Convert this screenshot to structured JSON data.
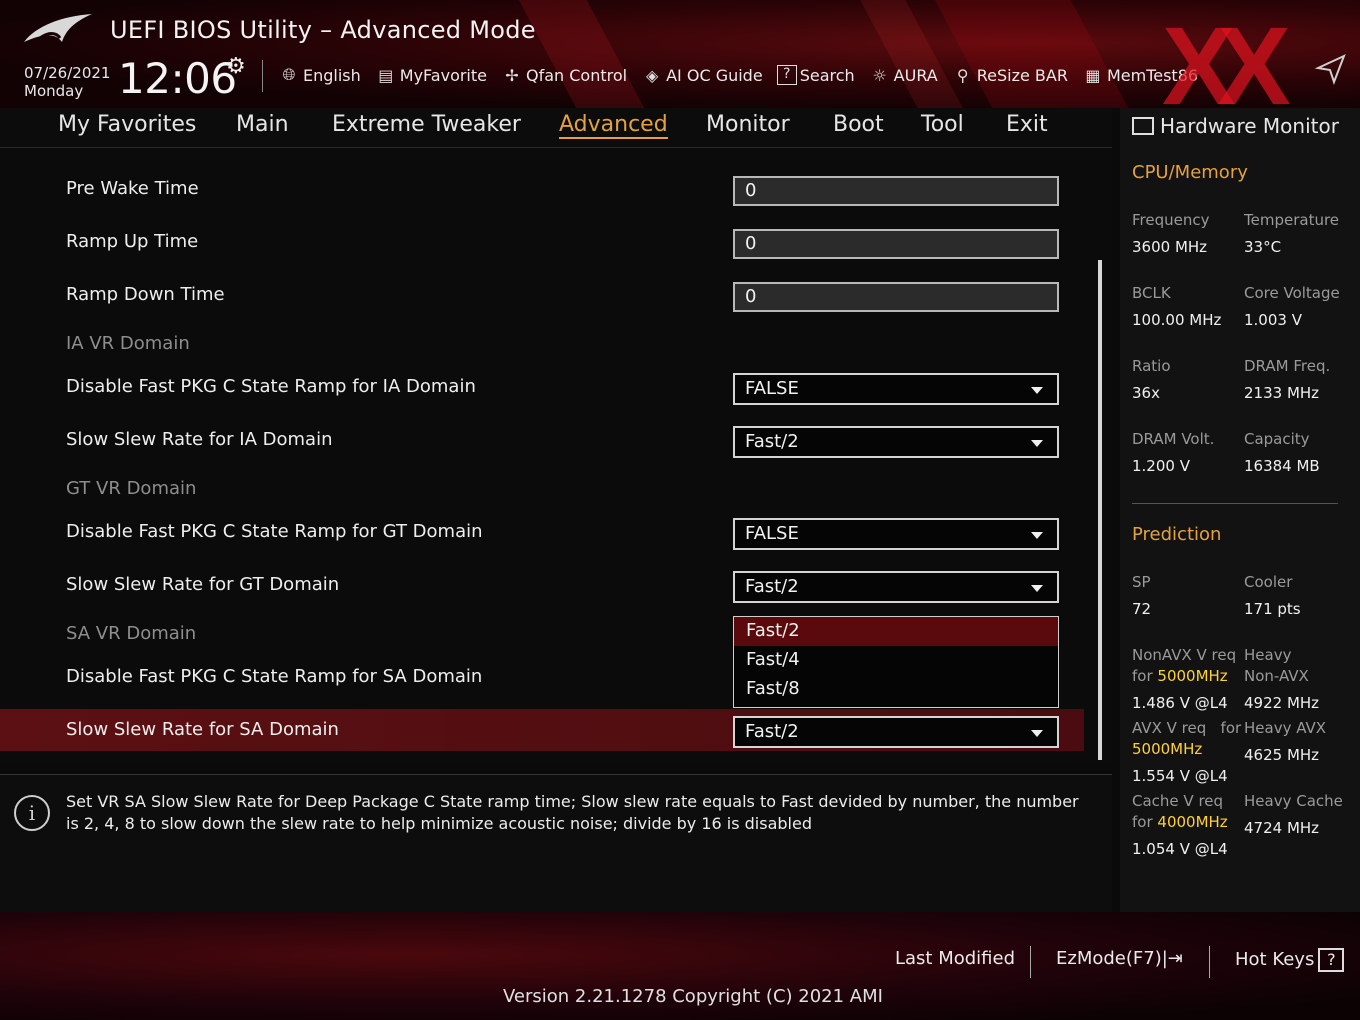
{
  "header": {
    "title": "UEFI BIOS Utility – Advanced Mode",
    "date": "07/26/2021",
    "day": "Monday",
    "time": "12:06",
    "toolbar": [
      {
        "icon": "globe-icon",
        "label": "English"
      },
      {
        "icon": "favorite-list-icon",
        "label": "MyFavorite"
      },
      {
        "icon": "fan-icon",
        "label": "Qfan Control"
      },
      {
        "icon": "ai-chip-icon",
        "label": "AI OC Guide"
      },
      {
        "icon": "search-help-icon",
        "label": "Search"
      },
      {
        "icon": "aura-light-icon",
        "label": "AURA"
      },
      {
        "icon": "resize-bar-icon",
        "label": "ReSize BAR"
      },
      {
        "icon": "memory-icon",
        "label": "MemTest86"
      }
    ]
  },
  "nav": {
    "tabs": [
      "My Favorites",
      "Main",
      "Extreme Tweaker",
      "Advanced",
      "Monitor",
      "Boot",
      "Tool",
      "Exit"
    ],
    "active": "Advanced"
  },
  "settings": {
    "pre_wake": {
      "label": "Pre Wake Time",
      "value": "0"
    },
    "ramp_up": {
      "label": "Ramp Up Time",
      "value": "0"
    },
    "ramp_down": {
      "label": "Ramp Down Time",
      "value": "0"
    },
    "ia_section": "IA VR Domain",
    "ia_fast_pkg": {
      "label": "Disable Fast PKG C State Ramp for IA Domain",
      "value": "FALSE"
    },
    "ia_slew": {
      "label": "Slow Slew Rate for IA Domain",
      "value": "Fast/2"
    },
    "gt_section": "GT VR Domain",
    "gt_fast_pkg": {
      "label": "Disable Fast PKG C State Ramp for GT Domain",
      "value": "FALSE"
    },
    "gt_slew": {
      "label": "Slow Slew Rate for GT Domain",
      "value": "Fast/2"
    },
    "sa_section": "SA VR Domain",
    "sa_fast_pkg": {
      "label": "Disable Fast PKG C State Ramp for SA Domain"
    },
    "sa_slew": {
      "label": "Slow Slew Rate for SA Domain",
      "value": "Fast/2"
    },
    "dropdown_options": [
      "Fast/2",
      "Fast/4",
      "Fast/8"
    ]
  },
  "help": {
    "text": "Set VR SA Slow Slew Rate for Deep Package C State ramp time; Slow slew rate equals to Fast devided by number, the number is 2, 4, 8 to slow down the slew rate to help minimize acoustic noise; divide by 16 is disabled"
  },
  "hw_monitor": {
    "title": "Hardware Monitor",
    "cpu_section": "CPU/Memory",
    "frequency_label": "Frequency",
    "frequency": "3600 MHz",
    "temperature_label": "Temperature",
    "temperature": "33°C",
    "bclk_label": "BCLK",
    "bclk": "100.00 MHz",
    "core_voltage_label": "Core Voltage",
    "core_voltage": "1.003 V",
    "ratio_label": "Ratio",
    "ratio": "36x",
    "dram_freq_label": "DRAM Freq.",
    "dram_freq": "2133 MHz",
    "dram_volt_label": "DRAM Volt.",
    "dram_volt": "1.200 V",
    "capacity_label": "Capacity",
    "capacity": "16384 MB",
    "prediction_section": "Prediction",
    "sp_label": "SP",
    "sp": "72",
    "cooler_label": "Cooler",
    "cooler": "171 pts",
    "nonavx_label_1": "NonAVX V req",
    "nonavx_label_2": "for",
    "nonavx_freq": "5000MHz",
    "nonavx_v": "1.486 V @L4",
    "heavy_nonavx_label_1": "Heavy",
    "heavy_nonavx_label_2": "Non-AVX",
    "heavy_nonavx": "4922 MHz",
    "avx_label": "AVX V req",
    "avx_for": "for",
    "avx_freq": "5000MHz",
    "avx_v": "1.554 V @L4",
    "heavy_avx_label": "Heavy AVX",
    "heavy_avx": "4625 MHz",
    "cache_label_1": "Cache V req",
    "cache_label_2": "for",
    "cache_freq": "4000MHz",
    "cache_v": "1.054 V @L4",
    "heavy_cache_label": "Heavy Cache",
    "heavy_cache": "4724 MHz"
  },
  "footer": {
    "last_modified": "Last Modified",
    "ezmode": "EzMode(F7)|",
    "hotkeys": "Hot Keys",
    "hotkeys_glyph": "?",
    "version": "Version 2.21.1278 Copyright (C) 2021 AMI"
  },
  "colors": {
    "accent": "#e4a23c",
    "selection": "#5c1013",
    "highlight": "#ffd230"
  }
}
